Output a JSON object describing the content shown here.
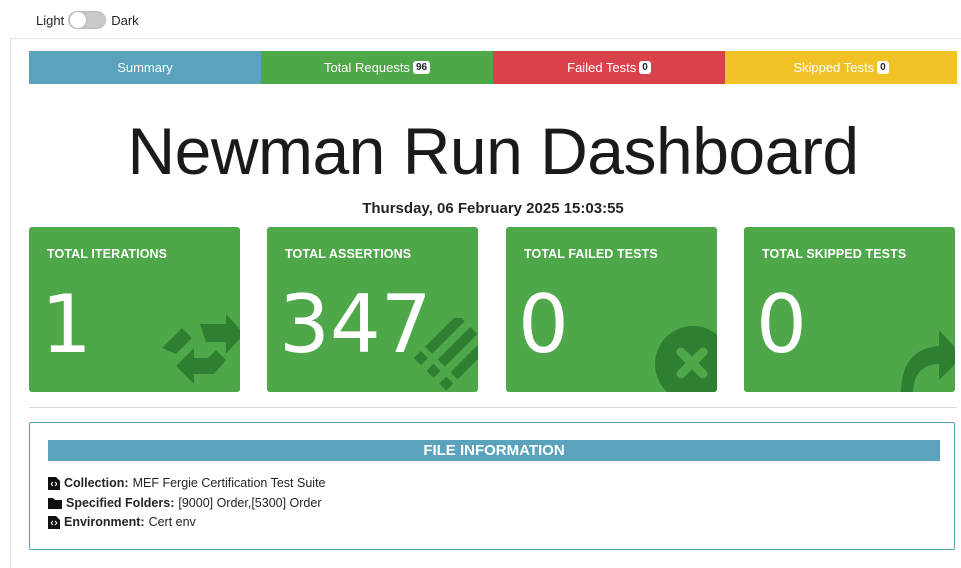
{
  "theme": {
    "light_label": "Light",
    "dark_label": "Dark"
  },
  "tabs": [
    {
      "label": "Summary",
      "badge": null,
      "color": "#5ba3bd"
    },
    {
      "label": "Total Requests",
      "badge": "96",
      "color": "#4ea84a"
    },
    {
      "label": "Failed Tests",
      "badge": "0",
      "color": "#d9424a"
    },
    {
      "label": "Skipped Tests",
      "badge": "0",
      "color": "#f0c226"
    }
  ],
  "header": {
    "title": "Newman Run Dashboard",
    "timestamp": "Thursday, 06 February 2025 15:03:55"
  },
  "cards": [
    {
      "label": "TOTAL ITERATIONS",
      "value": "1",
      "icon": "refresh-icon"
    },
    {
      "label": "TOTAL ASSERTIONS",
      "value": "347",
      "icon": "list-icon"
    },
    {
      "label": "TOTAL FAILED TESTS",
      "value": "0",
      "icon": "times-circle-icon"
    },
    {
      "label": "TOTAL SKIPPED TESTS",
      "value": "0",
      "icon": "share-arrow-icon"
    }
  ],
  "file_info": {
    "heading": "FILE INFORMATION",
    "collection_key": "Collection:",
    "collection_value": "MEF Fergie Certification Test Suite",
    "folders_key": "Specified Folders:",
    "folders_value": "[9000] Order,[5300] Order",
    "environment_key": "Environment:",
    "environment_value": "Cert env"
  },
  "colors": {
    "card_green": "#4ea84a",
    "icon_dark_green": "#2f7f33",
    "info_blue": "#5ba3bd"
  }
}
